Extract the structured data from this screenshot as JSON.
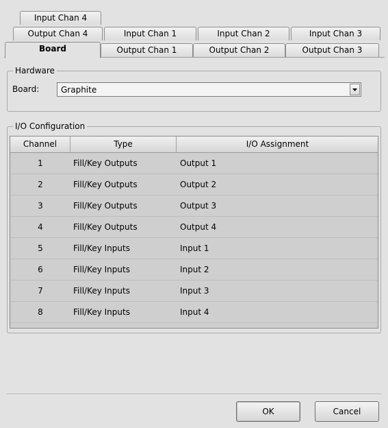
{
  "tabs": {
    "row1": [
      "Input Chan 4"
    ],
    "row2": [
      "Output Chan 4",
      "Input Chan 1",
      "Input Chan 2",
      "Input Chan 3"
    ],
    "row3": [
      "Board",
      "Output Chan 1",
      "Output Chan 2",
      "Output Chan 3"
    ],
    "active": "Board"
  },
  "hardware": {
    "legend": "Hardware",
    "board_label": "Board:",
    "board_value": "Graphite"
  },
  "io": {
    "legend": "I/O Configuration",
    "columns": [
      "Channel",
      "Type",
      "I/O Assignment"
    ],
    "rows": [
      {
        "channel": "1",
        "type": "Fill/Key Outputs",
        "assignment": "Output 1"
      },
      {
        "channel": "2",
        "type": "Fill/Key Outputs",
        "assignment": "Output 2"
      },
      {
        "channel": "3",
        "type": "Fill/Key Outputs",
        "assignment": "Output 3"
      },
      {
        "channel": "4",
        "type": "Fill/Key Outputs",
        "assignment": "Output 4"
      },
      {
        "channel": "5",
        "type": "Fill/Key Inputs",
        "assignment": "Input 1"
      },
      {
        "channel": "6",
        "type": "Fill/Key Inputs",
        "assignment": "Input 2"
      },
      {
        "channel": "7",
        "type": "Fill/Key Inputs",
        "assignment": "Input 3"
      },
      {
        "channel": "8",
        "type": "Fill/Key Inputs",
        "assignment": "Input 4"
      }
    ]
  },
  "buttons": {
    "ok": "OK",
    "cancel": "Cancel"
  }
}
